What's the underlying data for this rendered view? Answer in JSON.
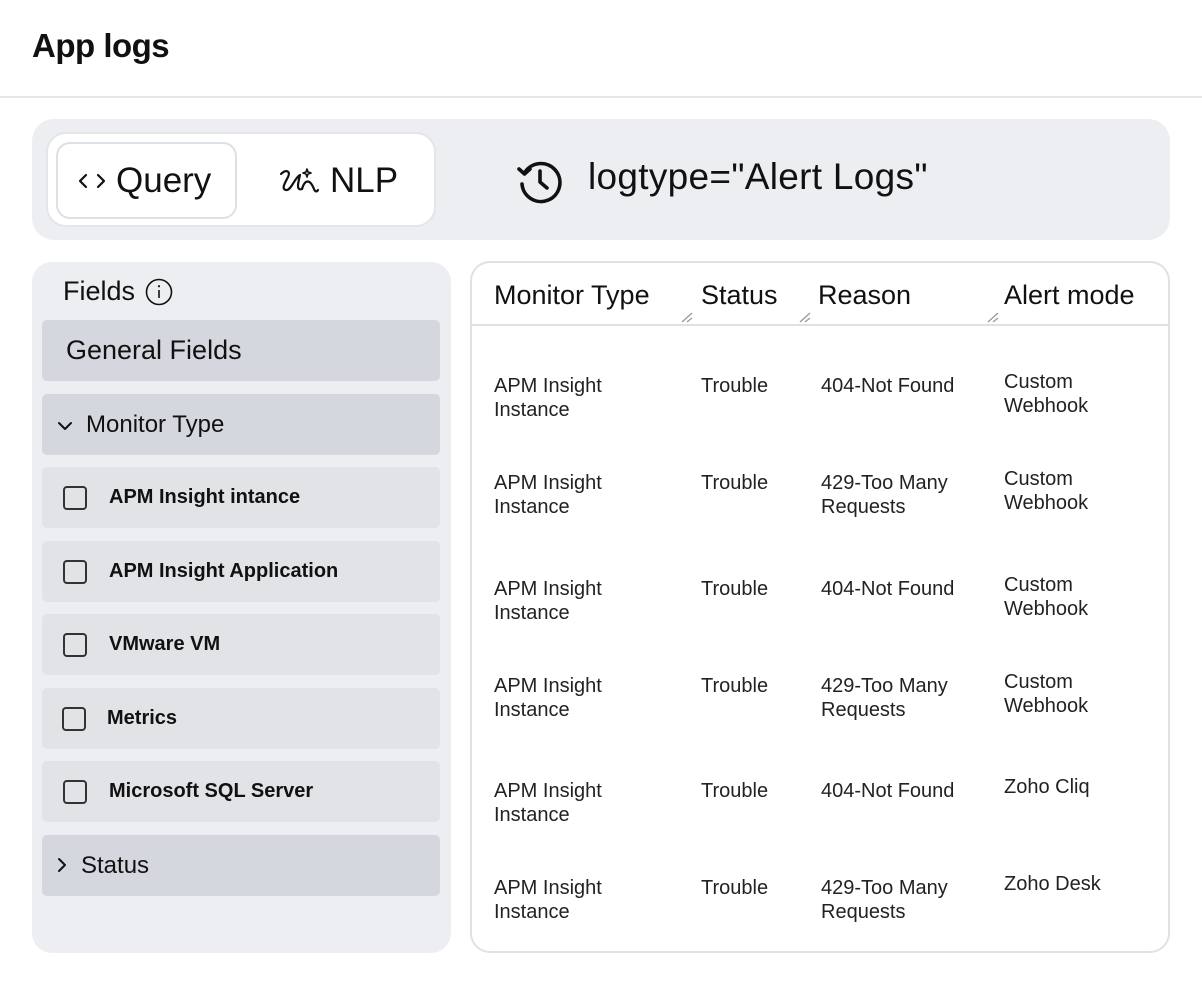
{
  "page": {
    "title": "App logs"
  },
  "query_bar": {
    "modes": [
      {
        "label": "Query",
        "icon": "code-icon",
        "selected": true
      },
      {
        "label": "NLP",
        "icon": "nlp-sparkle-icon",
        "selected": false
      }
    ],
    "query": "logtype=\"Alert Logs\""
  },
  "fields_panel": {
    "title": "Fields",
    "general_label": "General Fields",
    "monitor_type": {
      "label": "Monitor Type",
      "expanded": true,
      "options": [
        {
          "label": "APM Insight intance",
          "checked": false
        },
        {
          "label": "APM Insight Application",
          "checked": false
        },
        {
          "label": "VMware VM",
          "checked": false
        },
        {
          "label": "Metrics",
          "checked": false
        },
        {
          "label": "Microsoft SQL Server",
          "checked": false
        }
      ]
    },
    "status": {
      "label": "Status",
      "expanded": false
    }
  },
  "table": {
    "columns": [
      "Monitor Type",
      "Status",
      "Reason",
      "Alert mode"
    ],
    "rows": [
      {
        "monitor_type": "APM Insight Instance",
        "status": "Trouble",
        "reason": "404-Not Found",
        "alert_mode": "Custom Webhook"
      },
      {
        "monitor_type": "APM Insight Instance",
        "status": "Trouble",
        "reason": "429-Too Many Requests",
        "alert_mode": "Custom Webhook"
      },
      {
        "monitor_type": "APM Insight Instance",
        "status": "Trouble",
        "reason": "404-Not Found",
        "alert_mode": "Custom Webhook"
      },
      {
        "monitor_type": "APM Insight Instance",
        "status": "Trouble",
        "reason": "429-Too Many Requests",
        "alert_mode": "Custom Webhook"
      },
      {
        "monitor_type": "APM Insight Instance",
        "status": "Trouble",
        "reason": "404-Not Found",
        "alert_mode": "Zoho Cliq"
      },
      {
        "monitor_type": "APM Insight Instance",
        "status": "Trouble",
        "reason": "429-Too Many Requests",
        "alert_mode": "Zoho Desk"
      }
    ]
  }
}
